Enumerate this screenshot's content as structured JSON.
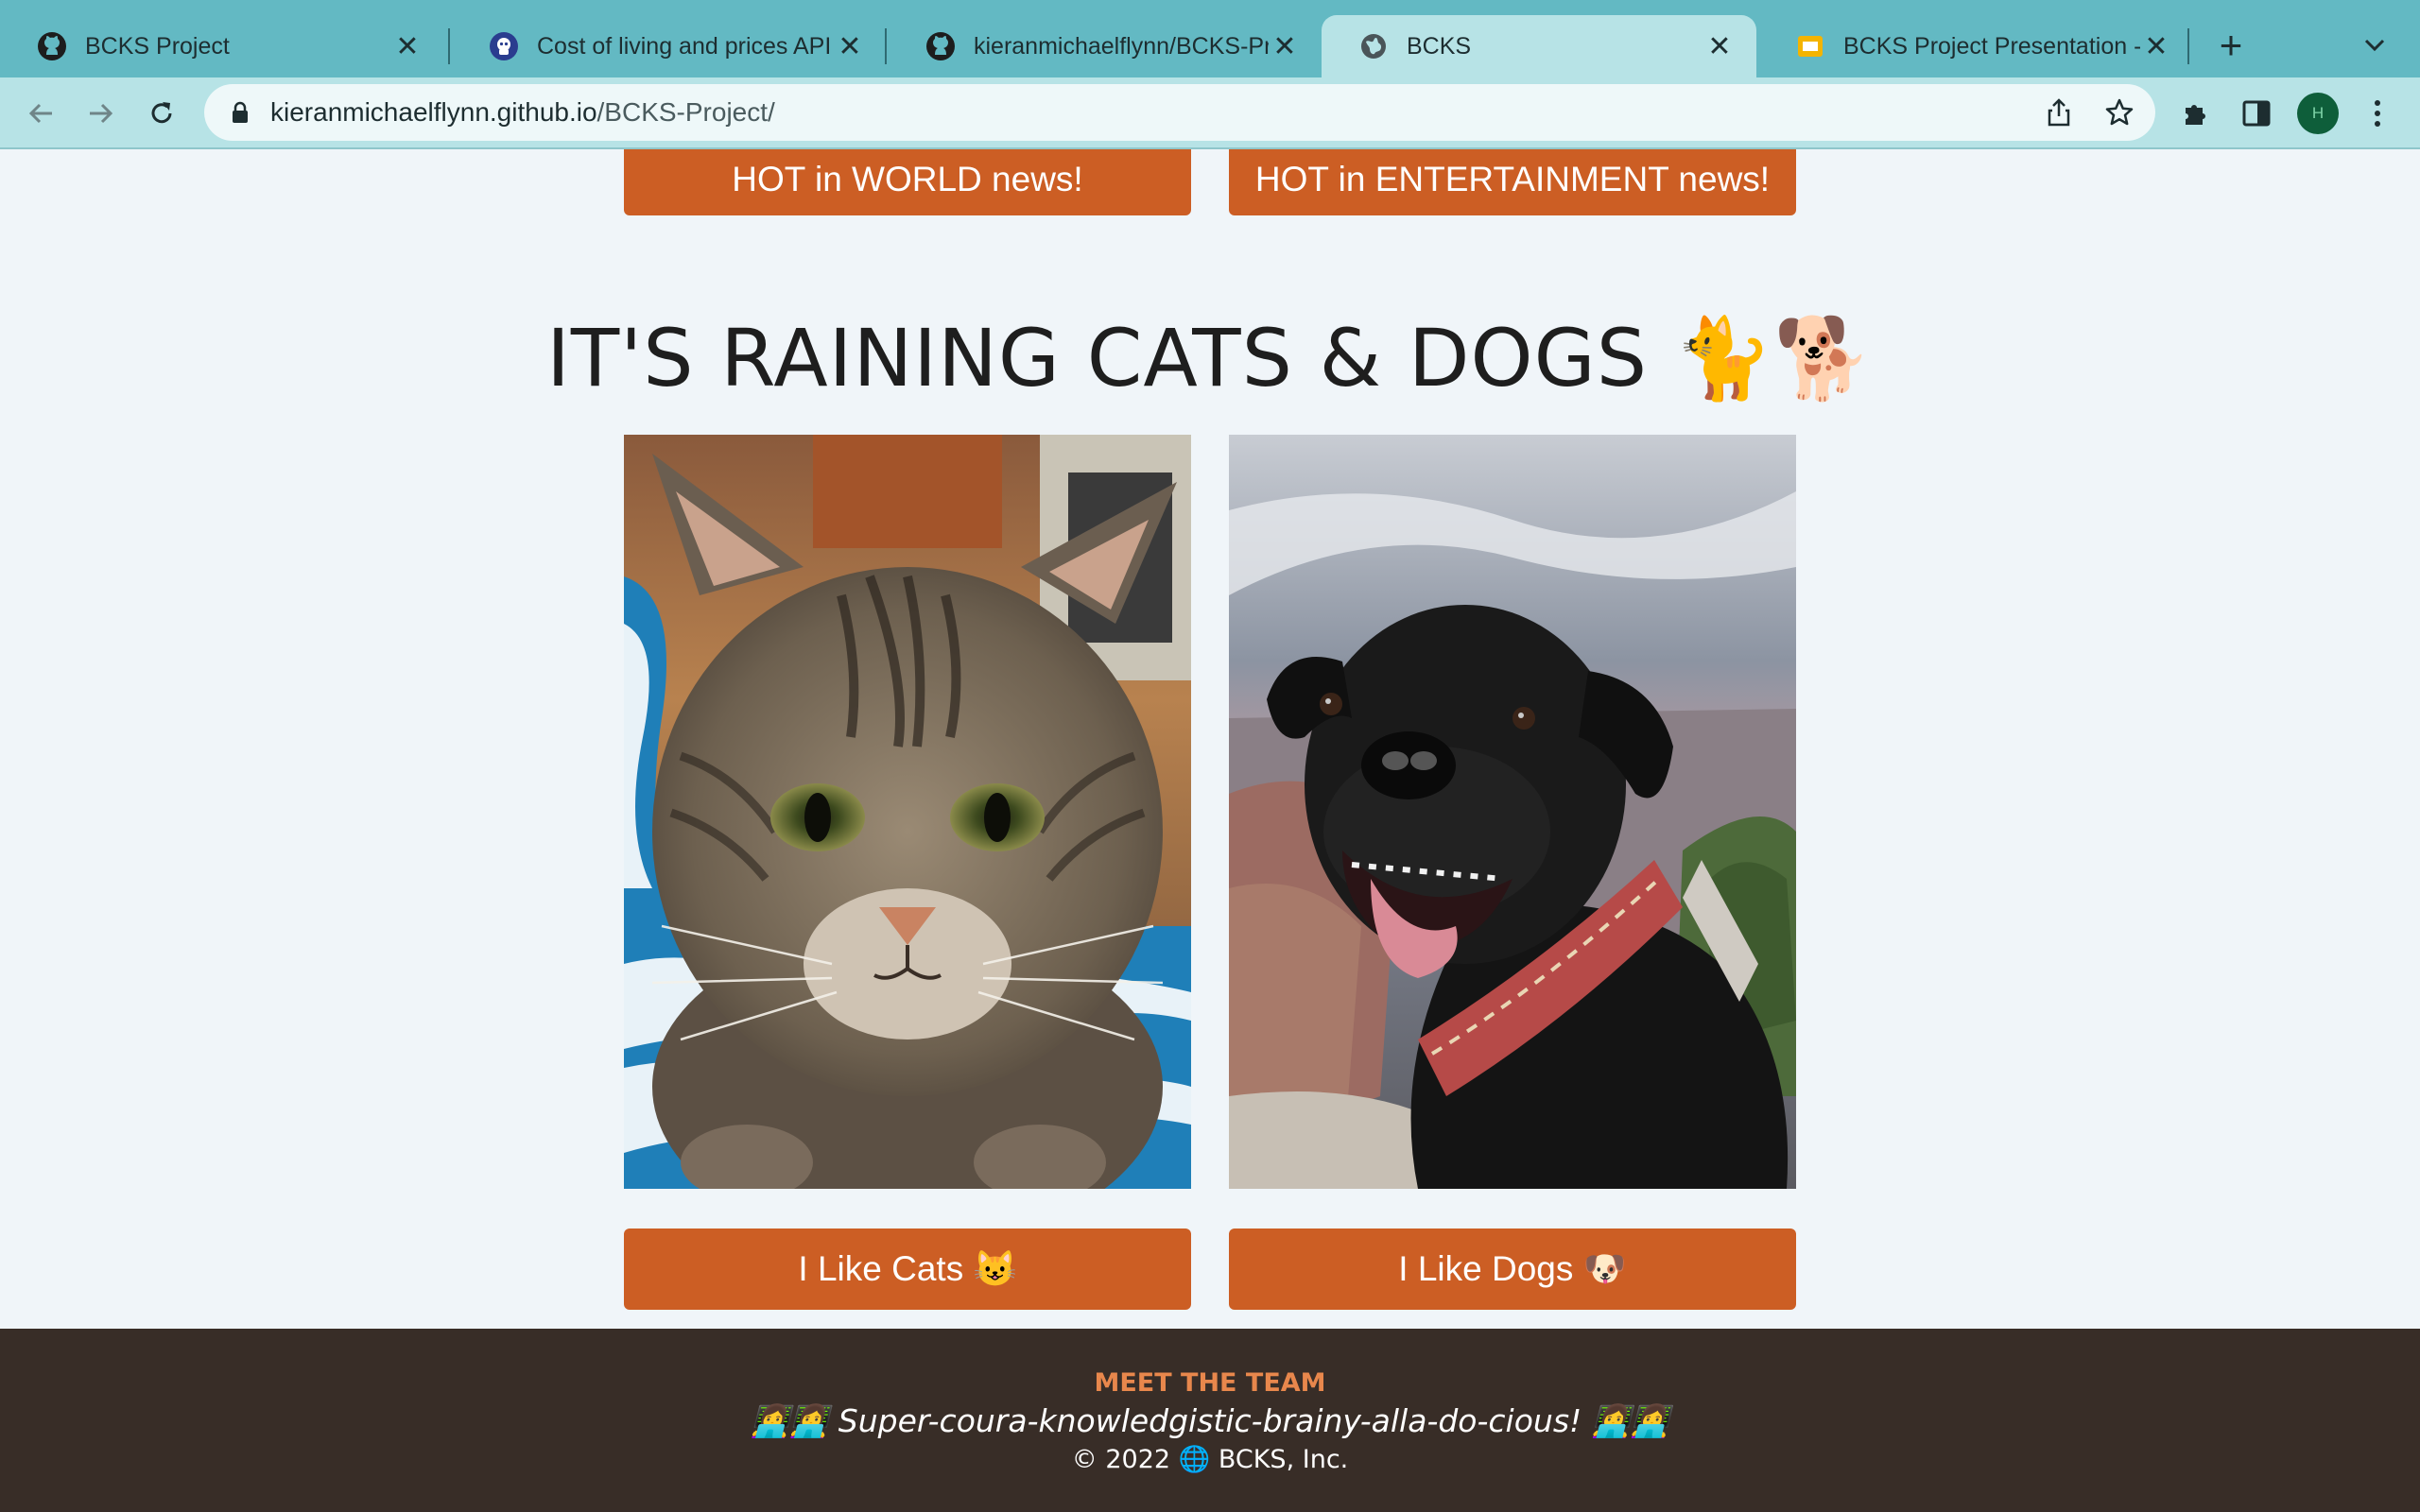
{
  "browser": {
    "tabs": [
      {
        "title": "BCKS Project",
        "icon": "github-icon",
        "active": false
      },
      {
        "title": "Cost of living and prices API I",
        "icon": "api-site-icon",
        "active": false
      },
      {
        "title": "kieranmichaelflynn/BCKS-Proj",
        "icon": "github-icon",
        "active": false
      },
      {
        "title": "BCKS",
        "icon": "globe-icon",
        "active": true
      },
      {
        "title": "BCKS Project Presentation - G",
        "icon": "slides-icon",
        "active": false
      }
    ],
    "close_glyph": "✕",
    "new_tab_glyph": "+",
    "address": {
      "domain": "kieranmichaelflynn.github.io",
      "path": "/BCKS-Project/"
    },
    "profile_initial": "H"
  },
  "news_buttons": {
    "world": "HOT in WORLD news!",
    "entertainment": "HOT in ENTERTAINMENT news!"
  },
  "pets_section": {
    "title": "IT'S RAINING CATS & DOGS 🐈🐕",
    "cat_photo": "tabby-cat-photo",
    "dog_photo": "black-dog-photo",
    "cat_button": "I Like Cats 😺",
    "dog_button": "I Like Dogs 🐶"
  },
  "footer": {
    "heading": "MEET THE TEAM",
    "motto": "👩‍💻👩‍💻 Super-coura-knowledgistic-brainy-alla-do-cious! 👩‍💻👩‍💻",
    "copyright": "© 2022 🌐 BCKS, Inc."
  },
  "colors": {
    "tabbar": "#63b9c3",
    "toolbar": "#b7e3e6",
    "page_bg": "#f0f5f9",
    "accent_button": "#cc5e24",
    "footer_bg": "#382d27",
    "footer_heading": "#e8874c"
  }
}
